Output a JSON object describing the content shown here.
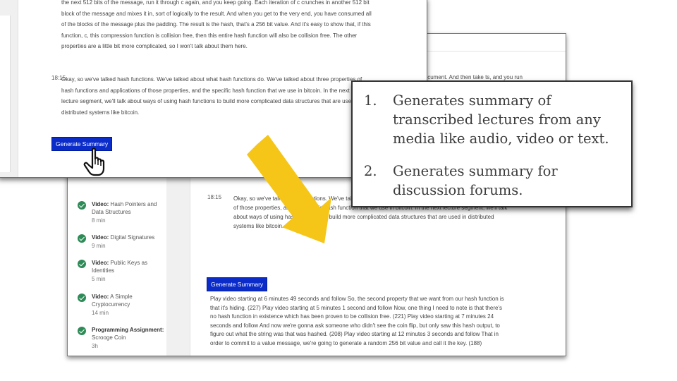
{
  "front_window": {
    "transcript_block_1": "the next 512 bits of the message, run it through c again, and you keep going. Each iteration of c crunches in another 512 bit block of the message and mixes it in, sort of logically to the result. And when you get to the very end, you have consumed all of the blocks of the message plus the padding. The result is the hash, that's a 256 bit value. And it's easy to show that, if this function, c, this compression function is collision free, then this entire hash function will also be collision free. The other properties are a little bit more complicated, so I won't talk about them here.",
    "timestamp_2": "18:15",
    "transcript_block_2": "Okay, so we've talked hash functions. We've talked about what hash functions do. We've talked about three properties of hash functions and applications of those properties, and the specific hash function that we use in bitcoin. In the next lecture segment, we'll talk about ways of using hash functions to build more complicated data structures that are used in distributed systems like bitcoin.",
    "generate_button": "Generate Summary"
  },
  "back_window": {
    "partial_text": "rds document. And then take ts, and you run them through",
    "timestamp": "18:15",
    "transcript": "Okay, so we've talked hash functions. We've talked about three properties of hash functions and applications of those properties, and the specific hash function that we use in bitcoin. In the next lecture segment, we'll talk about ways of using hash functions to build more complicated data structures that are used in distributed systems like bitcoin.",
    "generate_button": "Generate Summary",
    "summary": "Play video starting at 6 minutes 49 seconds and follow So, the second property that we want from our hash function is that it's hiding. (227) Play video starting at 5 minutes 1 second and follow Now, one thing I need to note is that there's no hash function in existence which has been proven to be collision free. (221) Play video starting at 7 minutes 24 seconds and follow And now we're gonna ask someone who didn't see the coin flip, but only saw this hash output, to figure out what the string was that was hashed. (208) Play video starting at 12 minutes 3 seconds and follow That in order to commit to a value message, we're going to generate a random 256 bit value and call it the key. (188)",
    "sidebar": [
      {
        "type": "Video:",
        "title": "Hash Pointers and Data Structures",
        "duration": "8 min"
      },
      {
        "type": "Video:",
        "title": "Digital Signatures",
        "duration": "9 min"
      },
      {
        "type": "Video:",
        "title": "Public Keys as Identities",
        "duration": "5 min"
      },
      {
        "type": "Video:",
        "title": "A Simple Cryptocurrency",
        "duration": "14 min"
      },
      {
        "type": "Programming Assignment:",
        "title": "Scrooge Coin",
        "duration": "3h"
      }
    ]
  },
  "callout": {
    "items": [
      {
        "num": "1.",
        "text": "Generates summary of transcribed lectures from any media like audio, video or text."
      },
      {
        "num": "2.",
        "text": "Generates summary for discussion forums."
      }
    ]
  },
  "colors": {
    "button_blue": "#0b2cc9",
    "check_green": "#2e8b57",
    "arrow_yellow": "#f5c518"
  },
  "icons": [
    "hand-pointer-icon",
    "check-circle-icon",
    "arrow-icon"
  ]
}
